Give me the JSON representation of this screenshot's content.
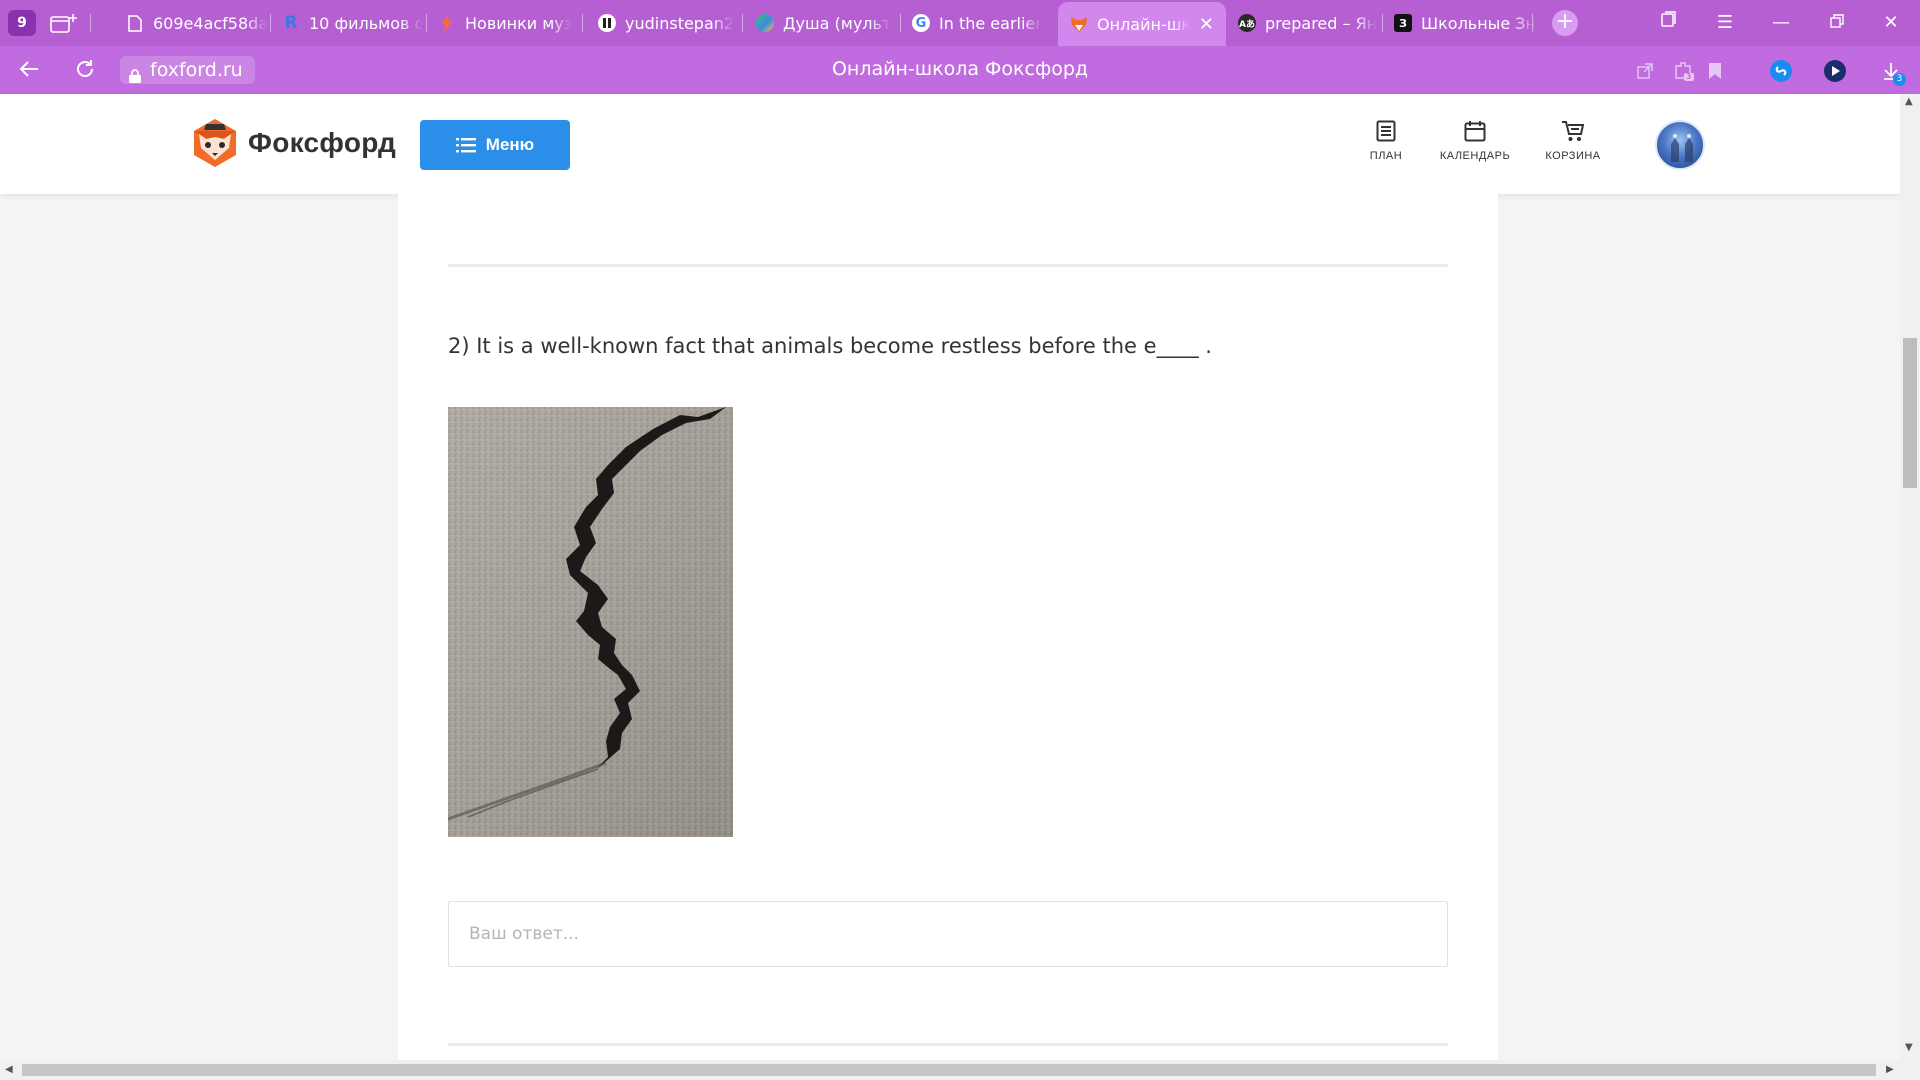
{
  "browser": {
    "tab_count": "9",
    "tabs": [
      {
        "title": "609e4acf58da",
        "icon": "document-icon"
      },
      {
        "title": "10 фильмов с",
        "icon": "r-logo-icon"
      },
      {
        "title": "Новинки муз",
        "icon": "lightning-icon"
      },
      {
        "title": "yudinstepan2",
        "icon": "pause-logo-icon"
      },
      {
        "title": "Душа (мульт",
        "icon": "globe-icon"
      },
      {
        "title": "In the earlier",
        "icon": "google-icon"
      },
      {
        "title": "Онлайн-шк",
        "icon": "fox-icon"
      },
      {
        "title": "prepared – Ян",
        "icon": "translate-icon"
      },
      {
        "title": "Школьные Зн",
        "icon": "znanija-icon"
      }
    ],
    "active_tab": 6,
    "url": "foxford.ru",
    "page_title": "Онлайн-школа Фоксфорд",
    "download_badge": "3",
    "extension_badge": "3"
  },
  "header": {
    "logo_text": "Фоксфорд",
    "menu_label": "Меню",
    "nav": [
      {
        "label": "ПЛАН",
        "icon": "plan-icon"
      },
      {
        "label": "КАЛЕНДАРЬ",
        "icon": "calendar-icon"
      },
      {
        "label": "КОРЗИНА",
        "icon": "cart-icon"
      }
    ]
  },
  "content": {
    "question": "2) It is a well-known fact that animals become restless before the e____ .",
    "image_subject": "cracked asphalt",
    "answer_placeholder": "Ваш ответ..."
  },
  "colors": {
    "browser_tabbar": "#b65fd3",
    "browser_addrbar": "#c06ce0",
    "menu_button": "#2b8ee8",
    "page_background": "#f4f4f4"
  }
}
